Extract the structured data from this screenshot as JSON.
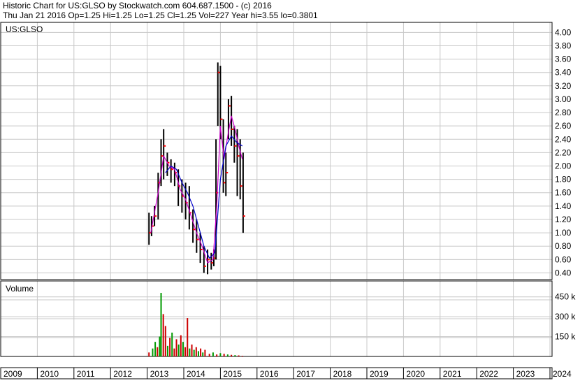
{
  "header": {
    "line1": "Historic Chart for US:GLSO by Stockwatch.com 604.687.1500 - (c) 2016",
    "line2": "Thu Jan 21 2016  Op=1.25  Hi=1.25  Lo=1.25  Cl=1.25  Vol=227  Year hi=3.55  lo=0.3801"
  },
  "colors": {
    "background": "#ffffff",
    "grid": "#c8c8c8",
    "border": "#000000",
    "price_bar": "#000000",
    "price_marker": "#ff0000",
    "ma_short": "#cc00cc",
    "ma_long": "#0000cc",
    "volume_up": "#009900",
    "volume_down": "#cc0000"
  },
  "chart_data": [
    {
      "type": "line",
      "title": "US:GLSO",
      "ylim": [
        0.3,
        4.15
      ],
      "y_ticks": [
        "0.40",
        "0.60",
        "0.80",
        "1.00",
        "1.20",
        "1.40",
        "1.60",
        "1.80",
        "2.00",
        "2.20",
        "2.40",
        "2.60",
        "2.80",
        "3.00",
        "3.20",
        "3.40",
        "3.60",
        "3.80",
        "4.00"
      ],
      "x_years": [
        "2009",
        "2010",
        "2011",
        "2012",
        "2013",
        "2014",
        "2015",
        "2016",
        "2017",
        "2018",
        "2019",
        "2020",
        "2021",
        "2022",
        "2023",
        "2024"
      ],
      "price_bars": [
        {
          "t": 2013.05,
          "hi": 1.3,
          "lo": 0.82,
          "cl": 1.0
        },
        {
          "t": 2013.12,
          "hi": 1.25,
          "lo": 0.95,
          "cl": 1.1
        },
        {
          "t": 2013.2,
          "hi": 1.4,
          "lo": 1.1,
          "cl": 1.25
        },
        {
          "t": 2013.3,
          "hi": 1.9,
          "lo": 1.2,
          "cl": 1.75
        },
        {
          "t": 2013.38,
          "hi": 2.4,
          "lo": 1.7,
          "cl": 2.15
        },
        {
          "t": 2013.45,
          "hi": 2.55,
          "lo": 1.8,
          "cl": 2.3
        },
        {
          "t": 2013.55,
          "hi": 2.2,
          "lo": 1.85,
          "cl": 2.05
        },
        {
          "t": 2013.65,
          "hi": 2.1,
          "lo": 1.75,
          "cl": 1.95
        },
        {
          "t": 2013.75,
          "hi": 2.05,
          "lo": 1.7,
          "cl": 1.9
        },
        {
          "t": 2013.85,
          "hi": 1.95,
          "lo": 1.4,
          "cl": 1.7
        },
        {
          "t": 2013.95,
          "hi": 1.8,
          "lo": 1.3,
          "cl": 1.55
        },
        {
          "t": 2014.05,
          "hi": 1.75,
          "lo": 1.2,
          "cl": 1.45
        },
        {
          "t": 2014.15,
          "hi": 1.7,
          "lo": 1.05,
          "cl": 1.3
        },
        {
          "t": 2014.25,
          "hi": 1.35,
          "lo": 0.85,
          "cl": 1.05
        },
        {
          "t": 2014.35,
          "hi": 1.2,
          "lo": 0.7,
          "cl": 0.9
        },
        {
          "t": 2014.45,
          "hi": 1.0,
          "lo": 0.55,
          "cl": 0.75
        },
        {
          "t": 2014.55,
          "hi": 0.8,
          "lo": 0.4,
          "cl": 0.5
        },
        {
          "t": 2014.65,
          "hi": 0.75,
          "lo": 0.38,
          "cl": 0.6
        },
        {
          "t": 2014.75,
          "hi": 0.7,
          "lo": 0.45,
          "cl": 0.55
        },
        {
          "t": 2014.82,
          "hi": 0.75,
          "lo": 0.5,
          "cl": 0.62
        },
        {
          "t": 2014.88,
          "hi": 2.4,
          "lo": 0.6,
          "cl": 1.6
        },
        {
          "t": 2014.93,
          "hi": 3.55,
          "lo": 2.6,
          "cl": 3.4
        },
        {
          "t": 2015.0,
          "hi": 3.5,
          "lo": 2.4,
          "cl": 2.7
        },
        {
          "t": 2015.08,
          "hi": 2.7,
          "lo": 1.6,
          "cl": 1.75
        },
        {
          "t": 2015.15,
          "hi": 2.2,
          "lo": 1.55,
          "cl": 1.9
        },
        {
          "t": 2015.22,
          "hi": 3.0,
          "lo": 2.4,
          "cl": 2.9
        },
        {
          "t": 2015.3,
          "hi": 3.05,
          "lo": 2.3,
          "cl": 2.55
        },
        {
          "t": 2015.38,
          "hi": 2.6,
          "lo": 2.05,
          "cl": 2.3
        },
        {
          "t": 2015.46,
          "hi": 2.55,
          "lo": 1.55,
          "cl": 2.15
        },
        {
          "t": 2015.54,
          "hi": 2.4,
          "lo": 1.5,
          "cl": 1.7
        },
        {
          "t": 2015.62,
          "hi": 2.2,
          "lo": 1.0,
          "cl": 1.25
        }
      ],
      "series": [
        {
          "t": [
            2013.1,
            2013.3,
            2013.45,
            2013.6,
            2013.75,
            2013.9,
            2014.05,
            2014.2,
            2014.35,
            2014.5,
            2014.65,
            2014.8,
            2014.9,
            2015.0,
            2015.1,
            2015.2,
            2015.3,
            2015.4,
            2015.5,
            2015.6
          ],
          "values": [
            1.0,
            1.6,
            2.15,
            2.0,
            1.95,
            1.65,
            1.5,
            1.25,
            1.0,
            0.8,
            0.55,
            0.6,
            1.4,
            2.6,
            2.1,
            2.45,
            2.75,
            2.55,
            2.3,
            2.1
          ]
        },
        {
          "t": [
            2013.5,
            2013.65,
            2013.8,
            2013.95,
            2014.1,
            2014.25,
            2014.4,
            2014.55,
            2014.7,
            2014.85,
            2015.0,
            2015.15,
            2015.3,
            2015.45,
            2015.6
          ],
          "values": [
            1.9,
            2.0,
            1.95,
            1.75,
            1.6,
            1.4,
            1.1,
            0.8,
            0.62,
            0.7,
            1.8,
            2.3,
            2.45,
            2.35,
            2.3
          ]
        }
      ]
    },
    {
      "type": "bar",
      "title": "Volume",
      "ylim": [
        0,
        570000
      ],
      "y_ticks": [
        "150 k",
        "300 k",
        "450 k"
      ],
      "t": [
        2013.05,
        2013.15,
        2013.22,
        2013.28,
        2013.34,
        2013.38,
        2013.44,
        2013.5,
        2013.56,
        2013.62,
        2013.68,
        2013.74,
        2013.8,
        2013.86,
        2013.92,
        2013.98,
        2014.04,
        2014.1,
        2014.16,
        2014.22,
        2014.28,
        2014.34,
        2014.4,
        2014.46,
        2014.52,
        2014.58,
        2014.7,
        2014.8,
        2014.9,
        2015.0,
        2015.1,
        2015.2,
        2015.3,
        2015.4,
        2015.5,
        2015.6
      ],
      "values": [
        30000,
        60000,
        110000,
        70000,
        150000,
        480000,
        320000,
        230000,
        80000,
        140000,
        180000,
        60000,
        130000,
        90000,
        160000,
        110000,
        70000,
        290000,
        60000,
        90000,
        50000,
        70000,
        40000,
        60000,
        30000,
        50000,
        20000,
        30000,
        15000,
        25000,
        20000,
        15000,
        12000,
        10000,
        8000,
        5000
      ],
      "direction": [
        "down",
        "up",
        "up",
        "down",
        "up",
        "up",
        "down",
        "down",
        "up",
        "down",
        "up",
        "down",
        "down",
        "up",
        "down",
        "up",
        "down",
        "down",
        "up",
        "down",
        "up",
        "down",
        "up",
        "down",
        "up",
        "down",
        "down",
        "up",
        "down",
        "up",
        "down",
        "up",
        "down",
        "up",
        "down",
        "down"
      ]
    }
  ]
}
